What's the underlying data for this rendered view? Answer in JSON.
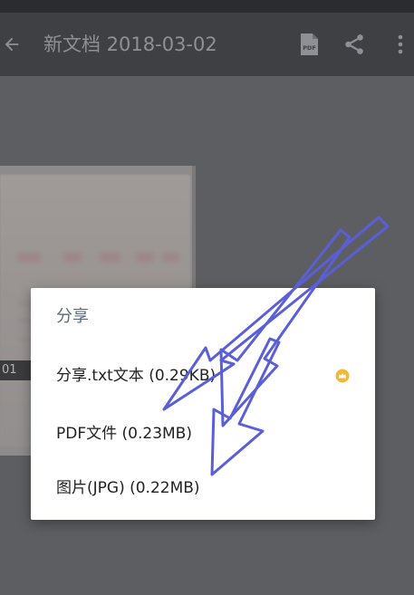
{
  "toolbar": {
    "title": "新文档 2018-03-02",
    "back_icon": "arrow-left-icon",
    "pdf_icon": "pdf-file-icon",
    "pdf_icon_text": "PDF",
    "share_icon": "share-icon",
    "more_icon": "more-vert-icon"
  },
  "thumbnail": {
    "page_label": "01"
  },
  "share_dialog": {
    "title": "分享",
    "options": [
      {
        "label": "分享.txt文本 (0.29KB)",
        "premium_icon": "crown-icon"
      },
      {
        "label": "PDF文件 (0.23MB)"
      },
      {
        "label": "图片(JPG) (0.22MB)"
      }
    ]
  },
  "colors": {
    "toolbar_bg": "#3f4043",
    "dim_bg": "#5d5e62",
    "annotation_arrow": "#5a5fd8",
    "crown": "#f0b93a"
  }
}
